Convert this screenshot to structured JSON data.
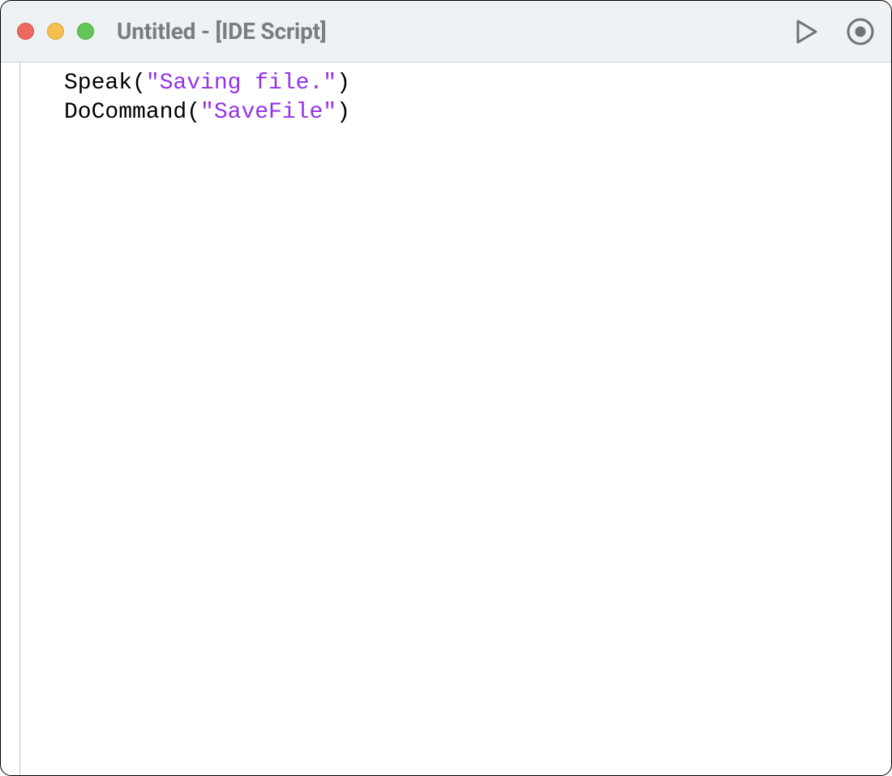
{
  "window": {
    "title": "Untitled - [IDE Script]"
  },
  "code": {
    "lines": [
      {
        "pre": "Speak(",
        "str": "\"Saving file.\"",
        "post": ")"
      },
      {
        "pre": "DoCommand(",
        "str": "\"SaveFile\"",
        "post": ")"
      }
    ]
  }
}
